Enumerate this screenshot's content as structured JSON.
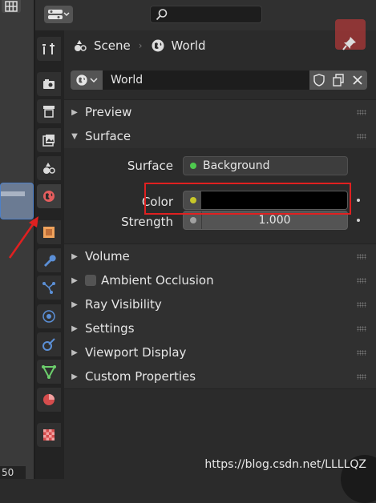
{
  "header": {
    "search_placeholder": ""
  },
  "breadcrumb": {
    "scene": "Scene",
    "world": "World"
  },
  "world_selector": {
    "name": "World"
  },
  "panels": {
    "preview": "Preview",
    "surface": "Surface",
    "volume": "Volume",
    "ambient_occlusion": "Ambient Occlusion",
    "ray_visibility": "Ray Visibility",
    "settings": "Settings",
    "viewport_display": "Viewport Display",
    "custom_properties": "Custom Properties"
  },
  "surface": {
    "surface_label": "Surface",
    "surface_value": "Background",
    "color_label": "Color",
    "strength_label": "Strength",
    "strength_value": "1.000",
    "color_value": "#000000"
  },
  "left": {
    "frame_number": "50"
  },
  "watermark": "https://blog.csdn.net/LLLLQZ",
  "colors": {
    "highlight": "#e02020",
    "shader_socket": "#4ec94e",
    "color_socket": "#c7c729",
    "value_socket": "#a1a1a1"
  }
}
